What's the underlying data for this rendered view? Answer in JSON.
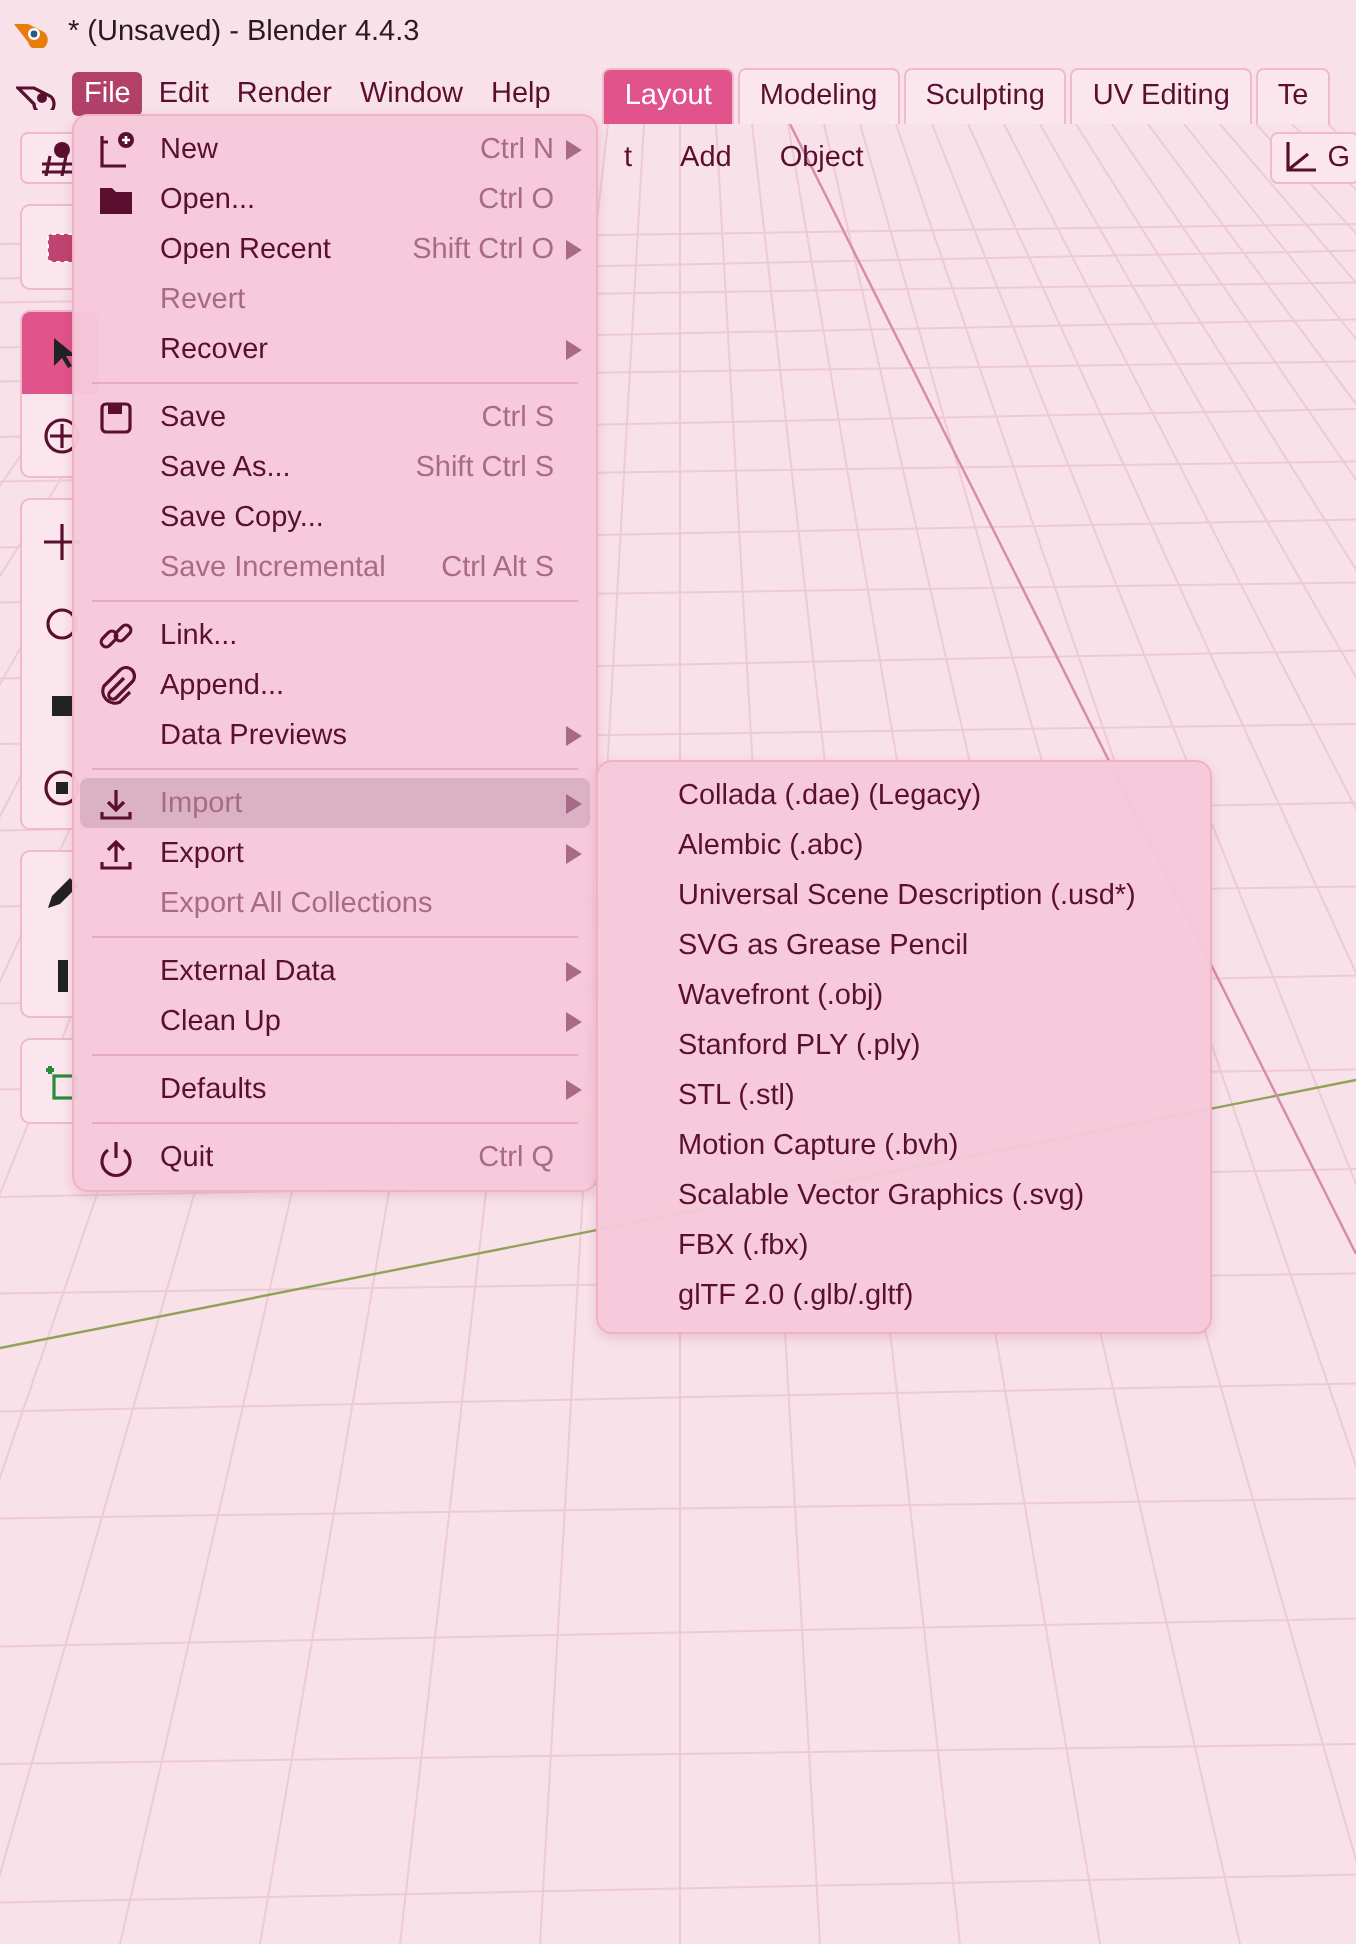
{
  "window": {
    "title": "* (Unsaved) - Blender 4.4.3"
  },
  "menubar": [
    {
      "label": "File",
      "selected": true
    },
    {
      "label": "Edit",
      "selected": false
    },
    {
      "label": "Render",
      "selected": false
    },
    {
      "label": "Window",
      "selected": false
    },
    {
      "label": "Help",
      "selected": false
    }
  ],
  "workspace_tabs": [
    {
      "label": "Layout",
      "selected": true
    },
    {
      "label": "Modeling",
      "selected": false
    },
    {
      "label": "Sculpting",
      "selected": false
    },
    {
      "label": "UV Editing",
      "selected": false
    },
    {
      "label": "Te",
      "selected": false
    }
  ],
  "viewport_header": {
    "menus": [
      "t",
      "Add",
      "Object"
    ],
    "gizmo_label": "G"
  },
  "file_menu": [
    [
      {
        "label": "New",
        "shortcut": "Ctrl N",
        "submenu": true,
        "disabled": false,
        "selected": false
      },
      {
        "label": "Open...",
        "shortcut": "Ctrl O",
        "submenu": false,
        "disabled": false,
        "selected": false
      },
      {
        "label": "Open Recent",
        "shortcut": "Shift Ctrl O",
        "submenu": true,
        "disabled": false,
        "selected": false
      },
      {
        "label": "Revert",
        "submenu": false,
        "disabled": true,
        "selected": false
      },
      {
        "label": "Recover",
        "submenu": true,
        "disabled": false,
        "selected": false
      }
    ],
    [
      {
        "label": "Save",
        "shortcut": "Ctrl S",
        "submenu": false,
        "disabled": false,
        "selected": false
      },
      {
        "label": "Save As...",
        "shortcut": "Shift Ctrl S",
        "submenu": false,
        "disabled": false,
        "selected": false
      },
      {
        "label": "Save Copy...",
        "submenu": false,
        "disabled": false,
        "selected": false
      },
      {
        "label": "Save Incremental",
        "shortcut": "Ctrl Alt S",
        "submenu": false,
        "disabled": true,
        "selected": false
      }
    ],
    [
      {
        "label": "Link...",
        "submenu": false,
        "disabled": false,
        "selected": false
      },
      {
        "label": "Append...",
        "submenu": false,
        "disabled": false,
        "selected": false
      },
      {
        "label": "Data Previews",
        "submenu": true,
        "disabled": false,
        "selected": false
      }
    ],
    [
      {
        "label": "Import",
        "submenu": true,
        "disabled": false,
        "selected": true
      },
      {
        "label": "Export",
        "submenu": true,
        "disabled": false,
        "selected": false
      },
      {
        "label": "Export All Collections",
        "submenu": false,
        "disabled": true,
        "selected": false
      }
    ],
    [
      {
        "label": "External Data",
        "submenu": true,
        "disabled": false,
        "selected": false
      },
      {
        "label": "Clean Up",
        "submenu": true,
        "disabled": false,
        "selected": false
      }
    ],
    [
      {
        "label": "Defaults",
        "submenu": true,
        "disabled": false,
        "selected": false
      }
    ],
    [
      {
        "label": "Quit",
        "shortcut": "Ctrl Q",
        "submenu": false,
        "disabled": false,
        "selected": false
      }
    ]
  ],
  "import_menu": [
    "Collada (.dae) (Legacy)",
    "Alembic (.abc)",
    "Universal Scene Description (.usd*)",
    "SVG as Grease Pencil",
    "Wavefront (.obj)",
    "Stanford PLY (.ply)",
    "STL (.stl)",
    "Motion Capture (.bvh)",
    "Scalable Vector Graphics (.svg)",
    "FBX (.fbx)",
    "glTF 2.0 (.glb/.gltf)"
  ]
}
